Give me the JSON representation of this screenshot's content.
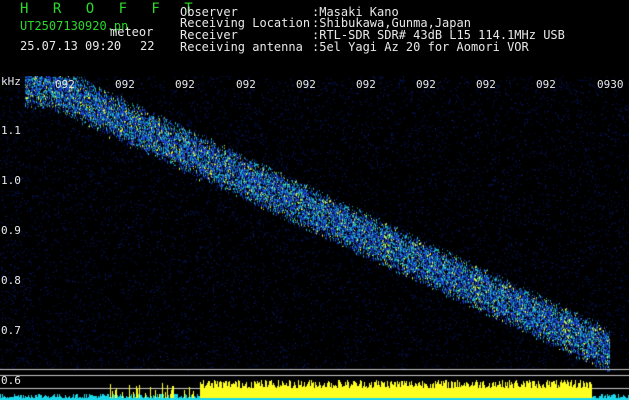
{
  "header": {
    "title": "H R O F F T",
    "filename": "UT2507130920.pn",
    "mode": "meteor",
    "datetime": "25.07.13 09:20",
    "count": "22",
    "fields": [
      {
        "label": "Observer",
        "value": ":Masaki Kano"
      },
      {
        "label": "Receiving Location",
        "value": ":Shibukawa,Gunma,Japan"
      },
      {
        "label": "Receiver",
        "value": ":RTL-SDR SDR# 43dB L15 114.1MHz USB"
      },
      {
        "label": "Receiving antenna",
        "value": ":5el Yagi Az 20 for Aomori VOR"
      }
    ]
  },
  "plot": {
    "y_unit": "kHz",
    "y_ticks": [
      "1.1",
      "1.0",
      "0.9",
      "0.8",
      "0.7",
      "0.6"
    ],
    "x_ticks": [
      "092",
      "092",
      "092",
      "092",
      "092",
      "092",
      "092",
      "092",
      "092",
      "0930"
    ]
  },
  "colors": {
    "background": "#000000",
    "noise": "#0a1a6e",
    "signal_low": "#1b3fd6",
    "signal_mid": "#20c0c8",
    "signal_high": "#f4ff30",
    "grid_line": "#c8c8c8",
    "bar_cyan": "#19d7ea",
    "bar_yellow": "#ffff20"
  }
}
